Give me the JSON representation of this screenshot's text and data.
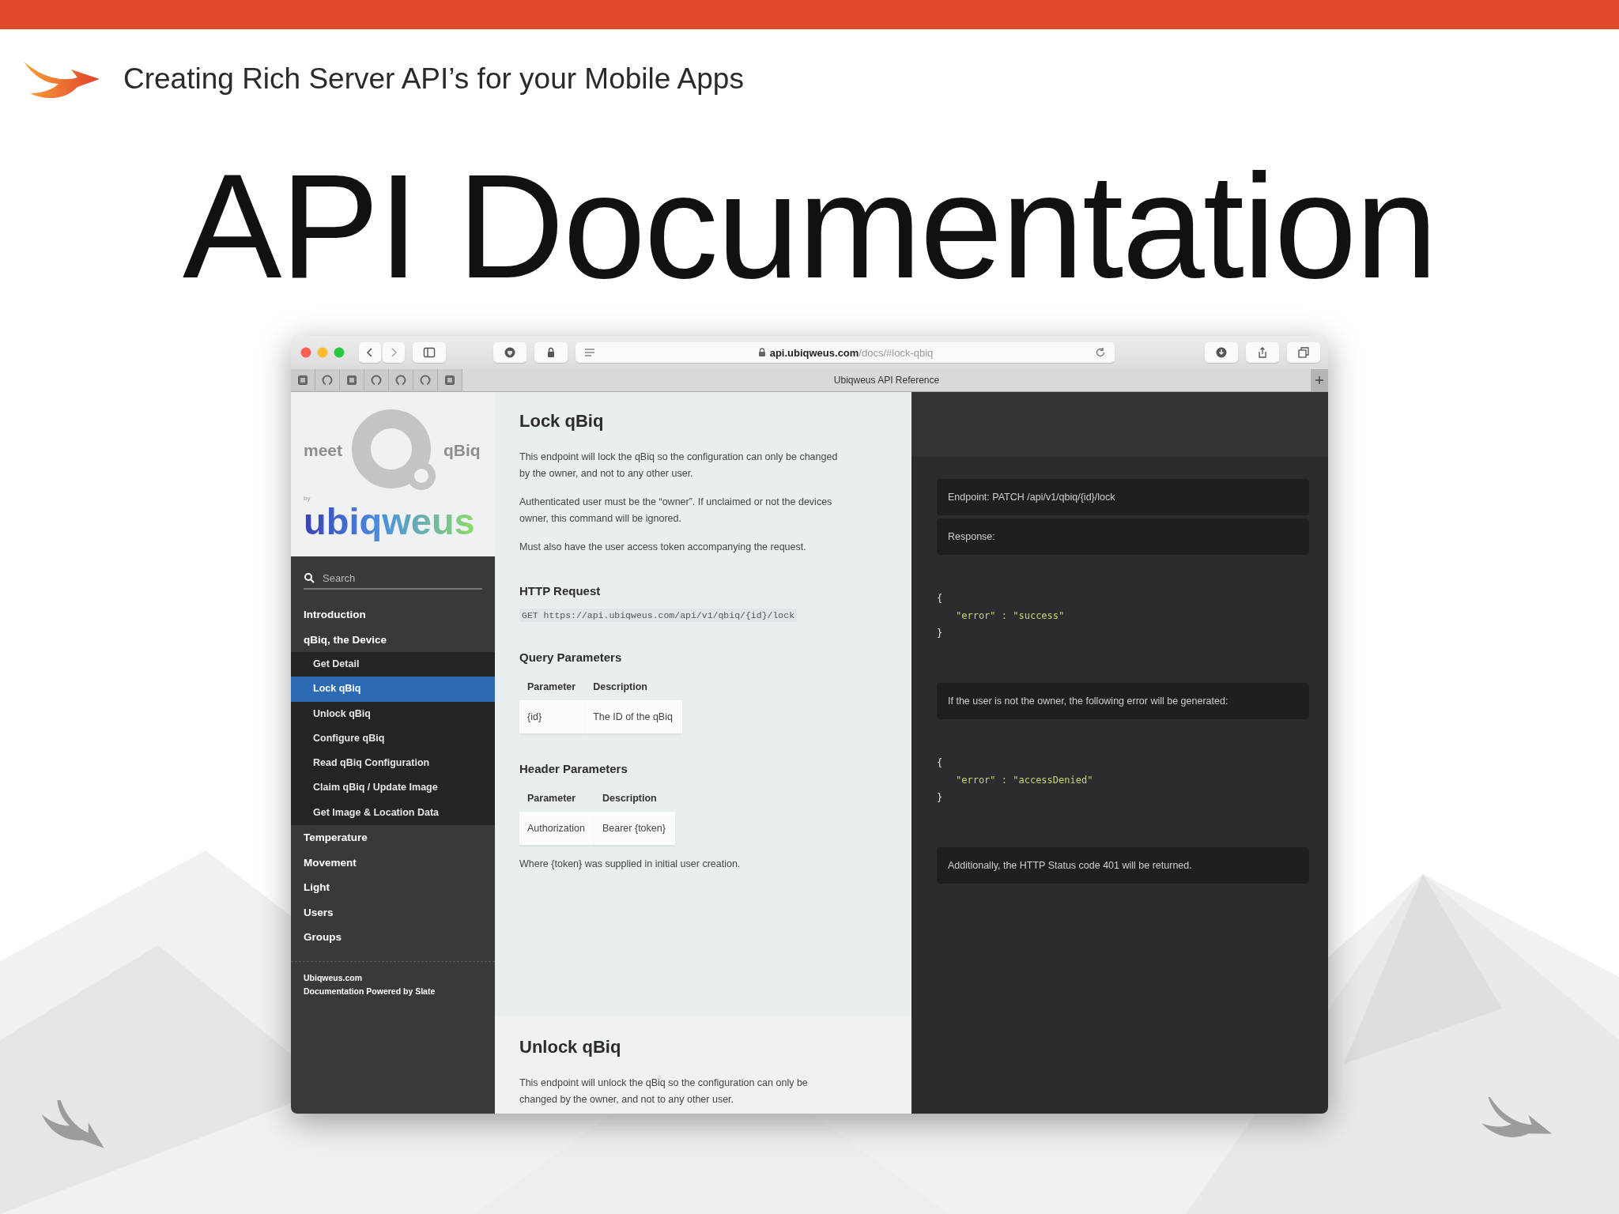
{
  "slide": {
    "header": "Creating Rich Server API’s for your Mobile Apps",
    "title": "API Documentation"
  },
  "browser": {
    "address": "**api.ubiqweus.com**/docs/#lock-qbiq",
    "tab_title": "Ubiqweus API Reference"
  },
  "sidebar": {
    "logo": {
      "meet": "meet",
      "product": "qBiq",
      "by": "by",
      "brand": "ubiqweus"
    },
    "search": {
      "placeholder": "Search"
    },
    "items": [
      {
        "label": "Introduction",
        "selected": false
      },
      {
        "label": "qBiq, the Device",
        "selected": false,
        "expanded": true,
        "children": [
          {
            "label": "Get Detail",
            "selected": false
          },
          {
            "label": "Lock qBiq",
            "selected": true
          },
          {
            "label": "Unlock qBiq",
            "selected": false
          },
          {
            "label": "Configure qBiq",
            "selected": false
          },
          {
            "label": "Read qBiq Configuration",
            "selected": false
          },
          {
            "label": "Claim qBiq / Update Image",
            "selected": false
          },
          {
            "label": "Get Image & Location Data",
            "selected": false
          }
        ]
      },
      {
        "label": "Temperature",
        "selected": false
      },
      {
        "label": "Movement",
        "selected": false
      },
      {
        "label": "Light",
        "selected": false
      },
      {
        "label": "Users",
        "selected": false
      },
      {
        "label": "Groups",
        "selected": false
      }
    ],
    "footer": [
      "Ubiqweus.com",
      "Documentation Powered by Slate"
    ]
  },
  "content": {
    "sections": [
      {
        "blocks": [
          {
            "kind": "h1",
            "text": "Lock qBiq"
          },
          {
            "kind": "p",
            "text": "This endpoint will lock the qBiq so the configuration can only be changed by the owner, and not to any other user."
          },
          {
            "kind": "p",
            "text": "Authenticated user must be the “owner”. If unclaimed or not the devices owner, this command will be ignored."
          },
          {
            "kind": "p",
            "text": "Must also have the user access token accompanying the request."
          },
          {
            "kind": "h2",
            "text": "HTTP Request"
          },
          {
            "kind": "code",
            "text": "GET https://api.ubiqweus.com/api/v1/qbiq/{id}/lock"
          },
          {
            "kind": "h2",
            "text": "Query Parameters"
          },
          {
            "kind": "table",
            "columns": [
              "Parameter",
              "Description"
            ],
            "rows": [
              [
                "{id}",
                "The ID of the qBiq"
              ]
            ]
          },
          {
            "kind": "h2",
            "text": "Header Parameters"
          },
          {
            "kind": "table",
            "columns": [
              "Parameter",
              "Description"
            ],
            "rows": [
              [
                "Authorization",
                "Bearer {token}"
              ]
            ]
          },
          {
            "kind": "p",
            "text": "Where {token} was supplied in initial user creation."
          }
        ]
      },
      {
        "blocks": [
          {
            "kind": "h1",
            "text": "Unlock qBiq"
          },
          {
            "kind": "p",
            "text": "This endpoint will unlock the qBiq so the configuration can only be changed by the owner, and not to any other user."
          }
        ]
      }
    ]
  },
  "code_pane": {
    "blocks": [
      {
        "kind": "note",
        "text": "Endpoint: PATCH /api/v1/qbiq/{id}/lock"
      },
      {
        "kind": "note",
        "text": "Response:"
      },
      {
        "kind": "code",
        "lines": [
          {
            "kind": "brace",
            "text": "{"
          },
          {
            "kind": "entry",
            "text": "\"error\" : \"success\""
          },
          {
            "kind": "brace",
            "text": "}"
          }
        ]
      },
      {
        "kind": "note",
        "text": "If the user is not the owner, the following error will be generated:"
      },
      {
        "kind": "code",
        "lines": [
          {
            "kind": "brace",
            "text": "{"
          },
          {
            "kind": "entry",
            "text": "\"error\" : \"accessDenied\""
          },
          {
            "kind": "brace",
            "text": "}"
          }
        ]
      },
      {
        "kind": "note",
        "text": "Additionally, the HTTP Status code 401 will be returned."
      }
    ]
  }
}
